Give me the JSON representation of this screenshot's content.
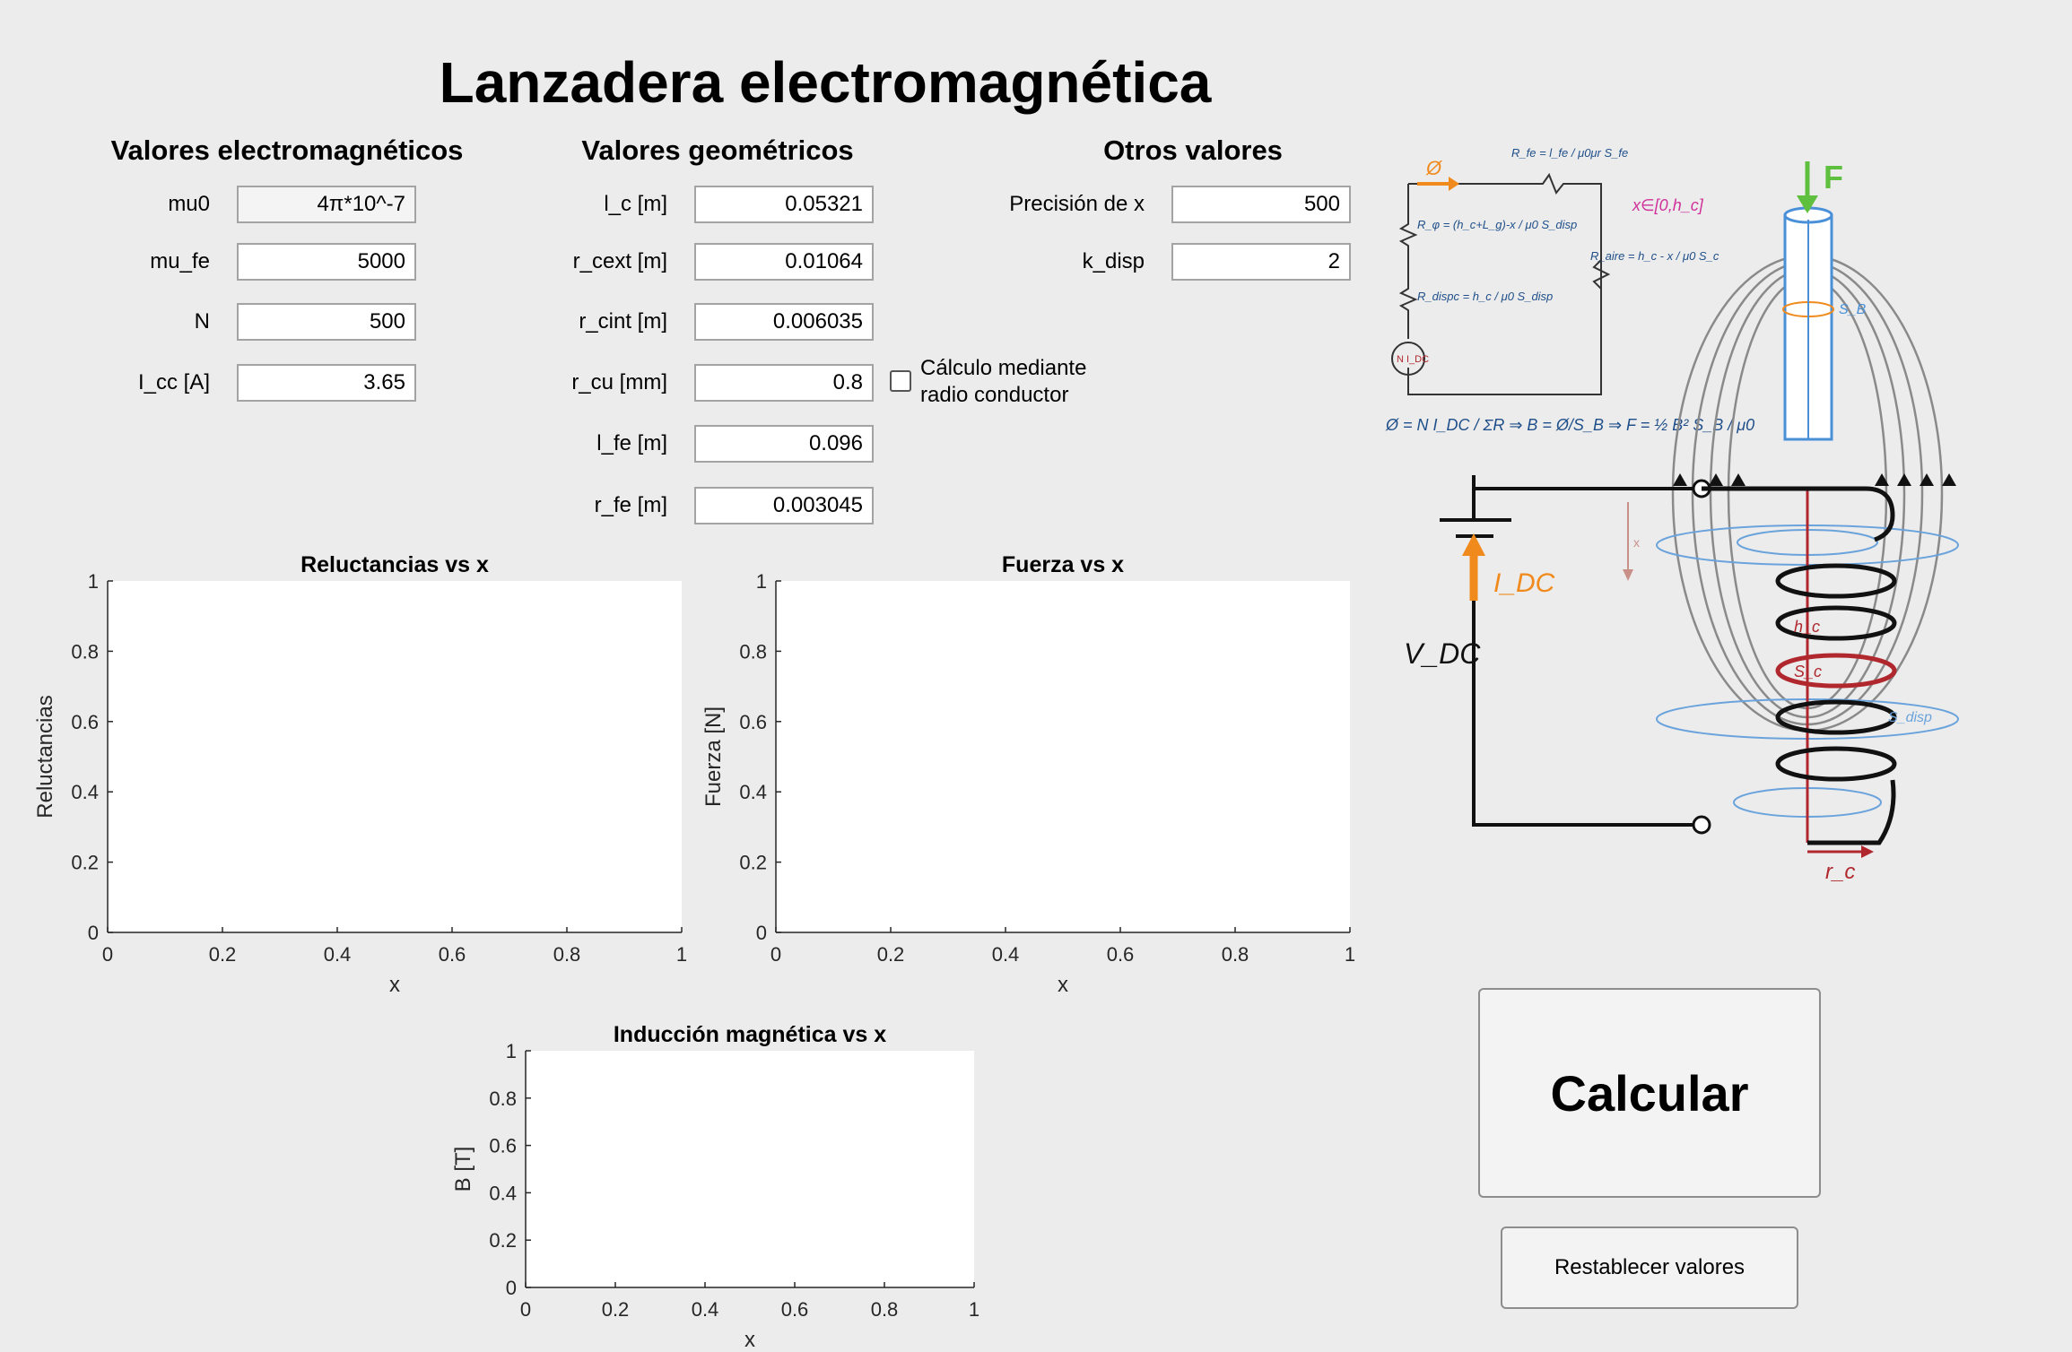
{
  "title": "Lanzadera electromagnética",
  "sections": {
    "electromagnetic": {
      "heading": "Valores electromagnéticos",
      "fields": [
        {
          "label": "mu0",
          "value": "4π*10^-7",
          "editable": false
        },
        {
          "label": "mu_fe",
          "value": "5000"
        },
        {
          "label": "N",
          "value": "500"
        },
        {
          "label": "I_cc [A]",
          "value": "3.65"
        }
      ]
    },
    "geometric": {
      "heading": "Valores geométricos",
      "fields": [
        {
          "label": "l_c [m]",
          "value": "0.05321"
        },
        {
          "label": "r_cext [m]",
          "value": "0.01064"
        },
        {
          "label": "r_cint [m]",
          "value": "0.006035"
        },
        {
          "label": "r_cu [mm]",
          "value": "0.8"
        },
        {
          "label": "l_fe [m]",
          "value": "0.096"
        },
        {
          "label": "r_fe [m]",
          "value": "0.003045"
        }
      ]
    },
    "other": {
      "heading": "Otros valores",
      "fields": [
        {
          "label": "Precisión de x",
          "value": "500"
        },
        {
          "label": "k_disp",
          "value": "2"
        }
      ],
      "checkbox": {
        "line1": "Cálculo mediante",
        "line2": "radio conductor",
        "checked": false
      }
    }
  },
  "buttons": {
    "calculate": "Calcular",
    "reset": "Restablecer valores"
  },
  "chart_data": [
    {
      "type": "line",
      "title": "Reluctancias vs x",
      "xlabel": "x",
      "ylabel": "Reluctancias",
      "xlim": [
        0,
        1
      ],
      "ylim": [
        0,
        1
      ],
      "xticks": [
        "0",
        "0.2",
        "0.4",
        "0.6",
        "0.8",
        "1"
      ],
      "yticks": [
        "0",
        "0.2",
        "0.4",
        "0.6",
        "0.8",
        "1"
      ],
      "series": []
    },
    {
      "type": "line",
      "title": "Fuerza vs x",
      "xlabel": "x",
      "ylabel": "Fuerza [N]",
      "xlim": [
        0,
        1
      ],
      "ylim": [
        0,
        1
      ],
      "xticks": [
        "0",
        "0.2",
        "0.4",
        "0.6",
        "0.8",
        "1"
      ],
      "yticks": [
        "0",
        "0.2",
        "0.4",
        "0.6",
        "0.8",
        "1"
      ],
      "series": []
    },
    {
      "type": "line",
      "title": "Inducción magnética vs x",
      "xlabel": "x",
      "ylabel": "B [T]",
      "xlim": [
        0,
        1
      ],
      "ylim": [
        0,
        1
      ],
      "xticks": [
        "0",
        "0.2",
        "0.4",
        "0.6",
        "0.8",
        "1"
      ],
      "yticks": [
        "0",
        "0.2",
        "0.4",
        "0.6",
        "0.8",
        "1"
      ],
      "series": []
    }
  ],
  "diagram": {
    "labels": {
      "voltage": "V_DC",
      "current": "I_DC",
      "force": "F",
      "range": "x∈[0,h_c]",
      "source": "N I_DC",
      "flux": "Ø",
      "coil_height": "h_c",
      "coil_area": "S_c",
      "disp_area": "S_disp",
      "bar_area": "S_B",
      "radius": "r_c",
      "x": "x",
      "r_bar": "R_fe = l_fe / μ0μr S_fe",
      "r_phi": "R_φ = (h_c+L_g)-x / μ0 S_disp",
      "r_dispc": "R_dispc = h_c / μ0 S_disp",
      "r_aire": "R_aire = h_c - x / μ0 S_c",
      "formula": "Ø = N I_DC / ΣR ⇒ B = Ø/S_B ⇒ F = ½ B² S_B / μ0"
    }
  }
}
